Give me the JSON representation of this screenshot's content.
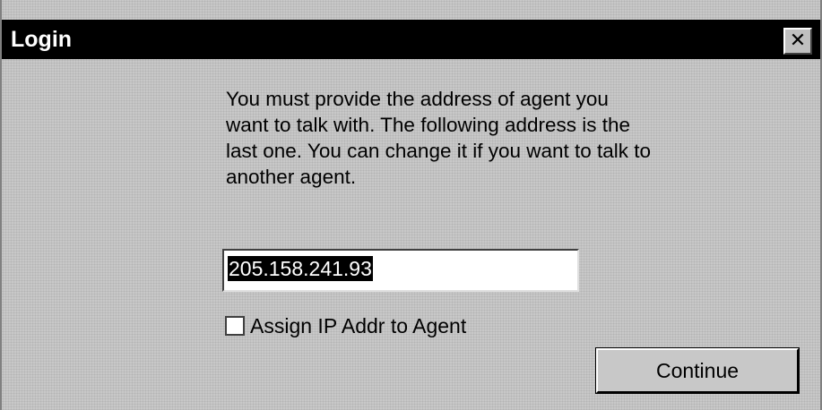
{
  "window": {
    "title": "Login",
    "close_glyph": "✕",
    "close_icon": "close-icon"
  },
  "message": {
    "lines": [
      "You must provide the address of agent you",
      "want to talk with. The following address is the",
      "last one. You can change it if you want to talk to",
      "another agent."
    ]
  },
  "address": {
    "value": "205.158.241.93",
    "selected": true
  },
  "assign_checkbox": {
    "label": "Assign IP Addr to Agent",
    "checked": false
  },
  "continue_button": {
    "label": "Continue"
  },
  "colors": {
    "titlebar": "#000000",
    "dialog_background": "#c8c8c8",
    "selection_highlight": "#000000"
  }
}
